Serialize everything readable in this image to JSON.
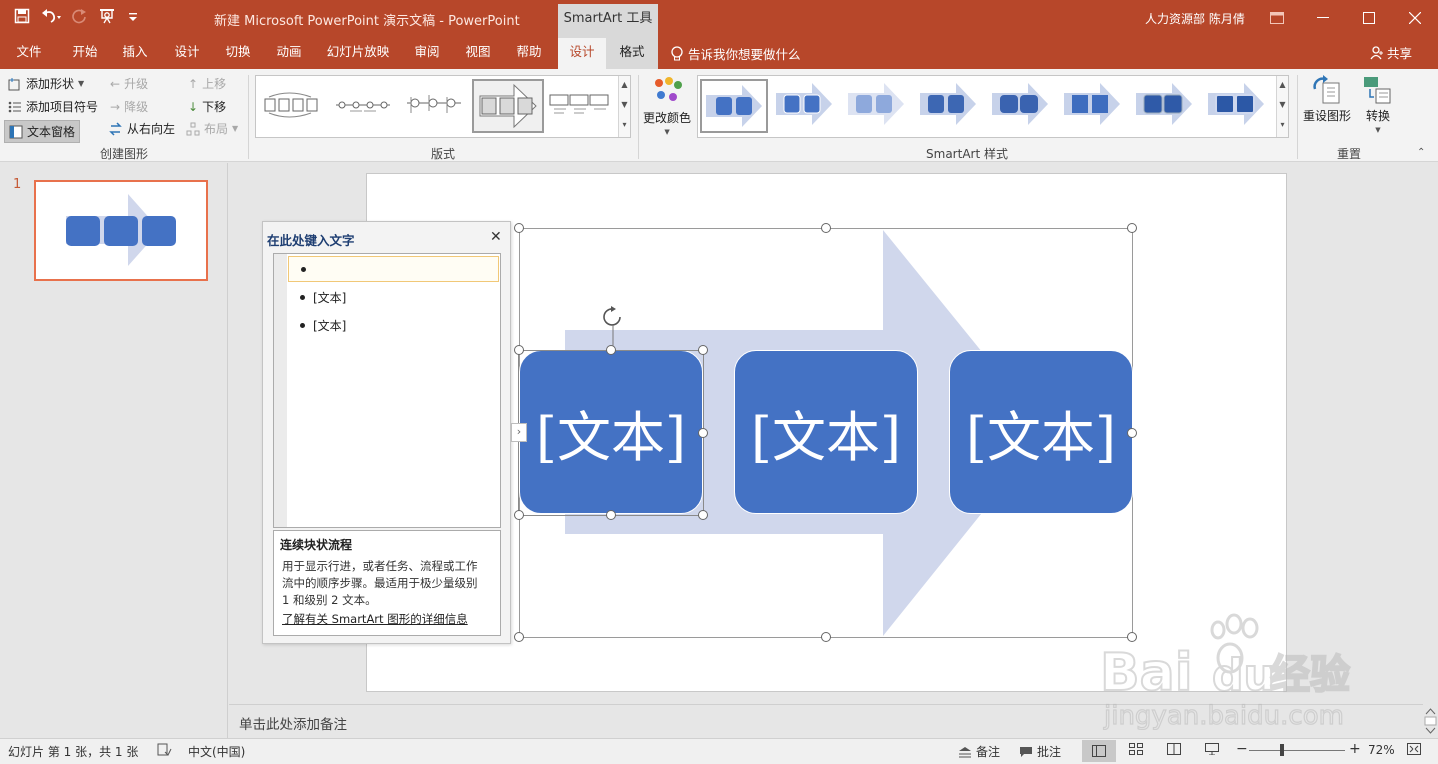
{
  "window": {
    "doc_title": "新建 Microsoft PowerPoint 演示文稿  -  PowerPoint",
    "context_tools": "SmartArt 工具",
    "user": "人力资源部 陈月倩"
  },
  "tabs": [
    "文件",
    "开始",
    "插入",
    "设计",
    "切换",
    "动画",
    "幻灯片放映",
    "审阅",
    "视图",
    "帮助",
    "设计",
    "格式"
  ],
  "tell_me": "告诉我你想要做什么",
  "share": "共享",
  "ribbon": {
    "create_group": {
      "label": "创建图形",
      "add_shape": "添加形状",
      "add_bullet": "添加项目符号",
      "text_pane": "文本窗格",
      "promote": "升级",
      "demote": "降级",
      "rtl": "从右向左",
      "move_up": "上移",
      "move_down": "下移",
      "layout": "布局"
    },
    "layouts_label": "版式",
    "styles": {
      "label": "SmartArt 样式",
      "change_colors": "更改颜色"
    },
    "reset": {
      "label": "重置",
      "reset_graphic": "重设图形",
      "convert": "转换"
    }
  },
  "thumbnails": {
    "slide_number": "1"
  },
  "text_pane": {
    "title": "在此处键入文字",
    "items": [
      "",
      "[文本]",
      "[文本]"
    ],
    "desc_title": "连续块状流程",
    "desc_lines": [
      "用于显示行进，或者任务、流程或工作",
      "流中的顺序步骤。最适用于极少量级别",
      "1 和级别 2 文本。"
    ],
    "link": "了解有关 SmartArt 图形的详细信息"
  },
  "smartart": {
    "boxes": [
      "[文本]",
      "[文本]",
      "[文本]"
    ],
    "box_color": "#4472c4",
    "arrow_color": "#d0d7ec"
  },
  "notes_placeholder": "单击此处添加备注",
  "status": {
    "slide_info": "幻灯片 第 1 张，共 1 张",
    "language": "中文(中国)",
    "notes": "备注",
    "comments": "批注",
    "zoom": "72%"
  },
  "colors": {
    "accent": "#b7472a",
    "ribbon_bg": "#f3f3f3"
  }
}
